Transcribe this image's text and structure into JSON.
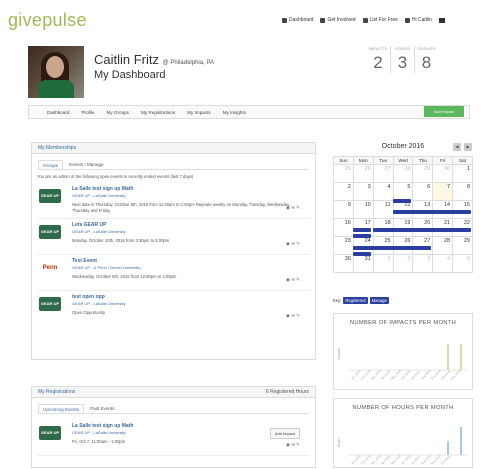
{
  "brand": {
    "logo": "givepulse"
  },
  "topnav": {
    "dashboard": "Dashboard",
    "get_involved": "Get Involved",
    "list_for_free": "List For Free",
    "user_greeting": "Hi Caitlin"
  },
  "profile": {
    "name": "Caitlin Fritz",
    "location": "@ Philadelphia, PA",
    "page_title": "My Dashboard"
  },
  "stats": [
    {
      "label": "IMPACTS",
      "value": "2"
    },
    {
      "label": "HOURS",
      "value": "3"
    },
    {
      "label": "GROUPS",
      "value": "8"
    }
  ],
  "subnav": [
    "Dashboard",
    "Profile",
    "My Groups",
    "My Registrations",
    "My Impacts",
    "My Insights"
  ],
  "add_impact_label": "Add Impact",
  "memberships": {
    "heading": "My Memberships",
    "tabs": [
      "Groups",
      "Events I Manage"
    ],
    "note": "You are an admin of the following open events in recently ended events (last 7 days)",
    "events": [
      {
        "logo": "GEAR UP",
        "title": "La Salle test sign up Math",
        "org": "GEAR UP - LaSalle University",
        "time": "Next date is Thursday, October 6th, 2016 from 11:00am to 1:00pm Repeats weekly on Monday, Tuesday, Wednesday, Thursday and Friday"
      },
      {
        "logo": "GEAR UP",
        "title": "Lets GEAR UP",
        "org": "GEAR UP - LaSalle University",
        "time": "Monday, October 10th, 2016 from 3:30pm to 5:00pm"
      },
      {
        "logo": "Penn",
        "title": "Test Event",
        "org": "GEAR UP - U Penn / Drexel University",
        "time": "Wednesday, October 5th, 2016 from 12:00pm to 4:00pm"
      },
      {
        "logo": "GEAR UP",
        "title": "test open opp",
        "org": "GEAR UP - LaSalle University",
        "time": "Open Opportunity"
      }
    ]
  },
  "calendar": {
    "month": "October 2016",
    "days": [
      "Sun",
      "Mon",
      "Tue",
      "Wed",
      "Thu",
      "Fri",
      "Sat"
    ],
    "weeks": [
      [
        "25",
        "26",
        "27",
        "28",
        "29",
        "30",
        "1"
      ],
      [
        "2",
        "3",
        "4",
        "5",
        "6",
        "7",
        "8"
      ],
      [
        "9",
        "10",
        "11",
        "12",
        "13",
        "14",
        "15"
      ],
      [
        "16",
        "17",
        "18",
        "19",
        "20",
        "21",
        "22"
      ],
      [
        "23",
        "24",
        "25",
        "26",
        "27",
        "28",
        "29"
      ],
      [
        "30",
        "31",
        "1",
        "2",
        "3",
        "4",
        "5"
      ]
    ],
    "key_label": "Key:",
    "key_items": [
      "Registered",
      "Manage"
    ]
  },
  "charts": {
    "impacts_title": "NUMBER OF IMPACTS PER MONTH",
    "hours_title": "NUMBER OF HOURS PER MONTH",
    "impacts_ylabel": "Impacts",
    "hours_ylabel": "Hours"
  },
  "registrations": {
    "heading": "My Registrations",
    "hours": "6 Registered Hours",
    "tabs": [
      "Upcoming Events",
      "Past Events"
    ],
    "event": {
      "title": "La Salle test sign up Math",
      "org": "GEAR UP - LaSalle University",
      "time": "Fri, Oct 7, 11:00am - 1:00pm",
      "button": "Add Impact"
    }
  },
  "colors": {
    "brand_green": "#9dbb55",
    "link_blue": "#3a6aa0",
    "event_chip": "#2b3fa0",
    "add_green": "#5cb85c"
  }
}
